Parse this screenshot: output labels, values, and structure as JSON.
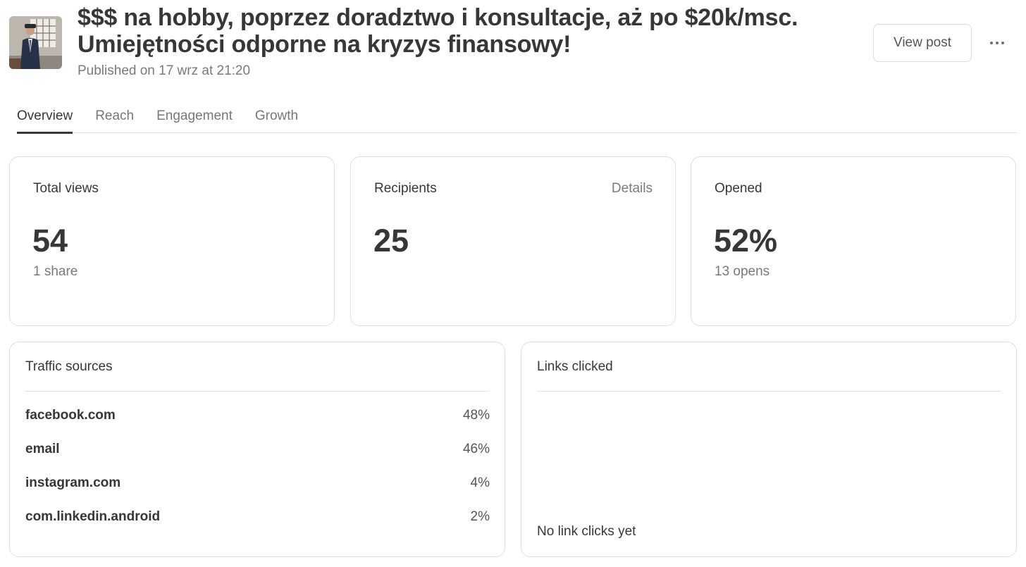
{
  "post": {
    "title_line1": "$$$ na hobby, poprzez doradztwo i konsultacje, aż po $20k/msc.",
    "title_line2": "Umiejętności odporne na kryzys finansowy!",
    "published": "Published on 17 wrz at 21:20"
  },
  "header": {
    "view_post_label": "View post",
    "more_icon": "more-horizontal-icon"
  },
  "tabs": [
    {
      "label": "Overview",
      "active": true
    },
    {
      "label": "Reach",
      "active": false
    },
    {
      "label": "Engagement",
      "active": false
    },
    {
      "label": "Growth",
      "active": false
    }
  ],
  "stats": {
    "total_views": {
      "label": "Total views",
      "value": "54",
      "sub": "1 share"
    },
    "recipients": {
      "label": "Recipients",
      "value": "25",
      "details_label": "Details"
    },
    "opened": {
      "label": "Opened",
      "value": "52%",
      "sub": "13 opens"
    }
  },
  "traffic_sources": {
    "title": "Traffic sources",
    "rows": [
      {
        "name": "facebook.com",
        "pct": "48%"
      },
      {
        "name": "email",
        "pct": "46%"
      },
      {
        "name": "instagram.com",
        "pct": "4%"
      },
      {
        "name": "com.linkedin.android",
        "pct": "2%"
      }
    ]
  },
  "links_clicked": {
    "title": "Links clicked",
    "empty": "No link clicks yet"
  },
  "colors": {
    "text": "#363737",
    "muted": "#7a7a7a",
    "border": "#dedede"
  }
}
